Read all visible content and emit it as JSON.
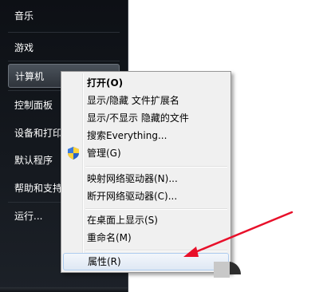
{
  "start_menu": {
    "items": [
      {
        "label": "音乐"
      },
      {
        "label": "游戏"
      },
      {
        "label": "计算机"
      },
      {
        "label": "控制面板"
      },
      {
        "label": "设备和打印"
      },
      {
        "label": "默认程序"
      },
      {
        "label": "帮助和支持"
      },
      {
        "label": "运行..."
      }
    ]
  },
  "context_menu": {
    "items": [
      {
        "label": "打开(O)"
      },
      {
        "label": "显示/隐藏 文件扩展名"
      },
      {
        "label": "显示/不显示 隐藏的文件"
      },
      {
        "label": "搜索Everything..."
      },
      {
        "label": "管理(G)",
        "icon": "shield-icon"
      },
      {
        "label": "映射网络驱动器(N)..."
      },
      {
        "label": "断开网络驱动器(C)..."
      },
      {
        "label": "在桌面上显示(S)"
      },
      {
        "label": "重命名(M)"
      },
      {
        "label": "属性(R)"
      }
    ]
  },
  "colors": {
    "start_bg": "#15191f",
    "menu_bg": "#f0f0f0",
    "arrow": "#e8102a",
    "hover_border": "#aeccef"
  }
}
